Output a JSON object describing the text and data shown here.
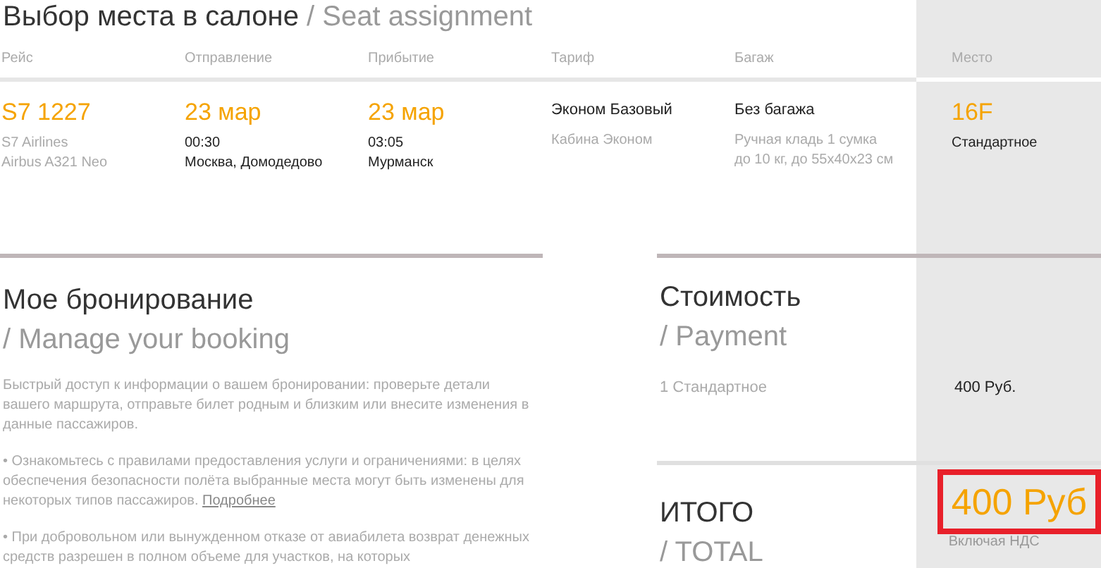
{
  "title": {
    "main": "Выбор места в салоне",
    "sub": "/ Seat assignment"
  },
  "flight_table": {
    "columns": [
      "Рейс",
      "Отправление",
      "Прибытие",
      "Тариф",
      "Багаж",
      "Место"
    ],
    "cells": [
      {
        "kind": "flight",
        "headline": "S7 1227",
        "lines": [
          "S7 Airlines",
          "Airbus A321 Neo"
        ]
      },
      {
        "kind": "time",
        "headline": "23 мар",
        "lines": [
          "00:30",
          "Москва, Домодедово"
        ]
      },
      {
        "kind": "time",
        "headline": "23 мар",
        "lines": [
          "03:05",
          "Мурманск"
        ]
      },
      {
        "kind": "fare",
        "headline": "Эконом Базовый",
        "lines": [
          "Кабина Эконом"
        ]
      },
      {
        "kind": "fare",
        "headline": "Без багажа",
        "lines": [
          "Ручная кладь 1 сумка до 10 кг, до 55x40x23 см"
        ]
      },
      {
        "kind": "seat",
        "headline": "16F",
        "lines": [
          "Стандартное"
        ]
      }
    ]
  },
  "booking": {
    "heading": "Мое бронирование",
    "subheading": "/ Manage your booking",
    "paragraphs": [
      {
        "text": "Быстрый доступ к информации о вашем бронировании: проверьте детали вашего маршрута, отправьте билет родным и близким или внесите изменения в данные пассажиров."
      },
      {
        "text": "• Ознакомьтесь с правилами предоставления услуги и ограничениями: в целях обеспечения безопасности полёта выбранные места могут быть изменены для некоторых типов пассажиров.",
        "link": "Подробнее"
      },
      {
        "text": "• При добровольном или вынужденном отказе от авиабилета возврат денежных средств разрешен в полном объеме для участков, на которых"
      }
    ]
  },
  "payment": {
    "heading": "Стоимость",
    "subheading": "/ Payment",
    "items": [
      {
        "label": "1 Стандартное",
        "amount": "400 Руб."
      }
    ],
    "total": {
      "heading": "ИТОГО",
      "subheading": "/ TOTAL",
      "amount": "400 Руб",
      "highlighted": true,
      "note": "Включая НДС"
    }
  }
}
